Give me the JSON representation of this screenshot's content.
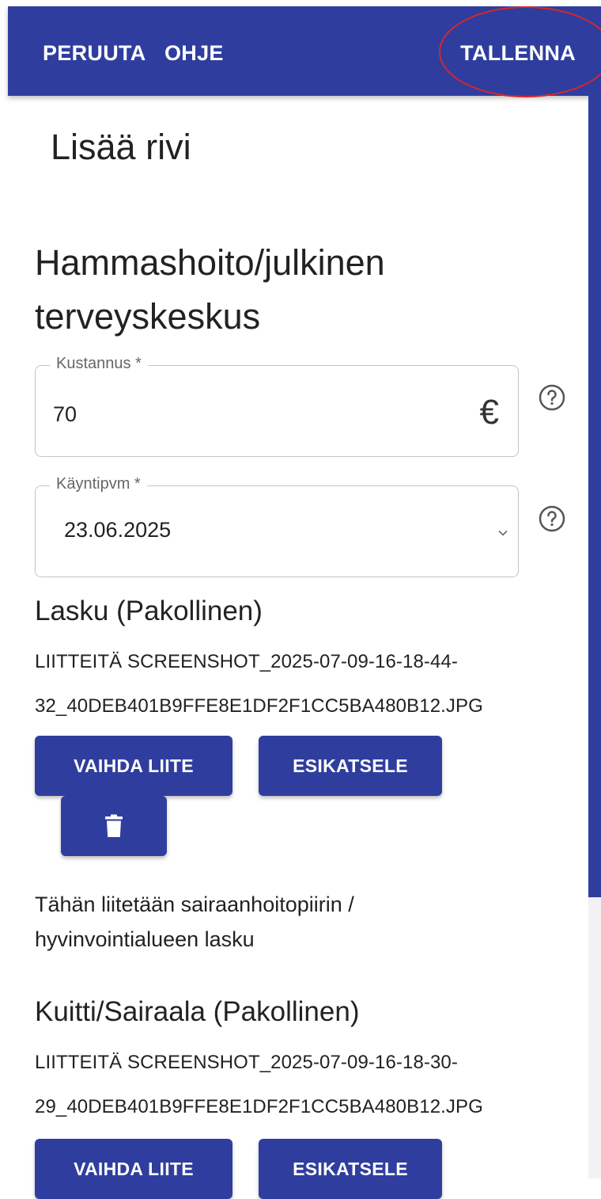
{
  "appbar": {
    "cancel_label": "PERUUTA",
    "help_label": "OHJE",
    "save_label": "TALLENNA"
  },
  "page_title": "Lisää rivi",
  "section_title": "Hammashoito/julkinen terveyskeskus",
  "cost": {
    "label": "Kustannus *",
    "value": "70",
    "currency_symbol": "€"
  },
  "visit_date": {
    "label": "Käyntipvm *",
    "value": "23.06.2025"
  },
  "invoice": {
    "title": "Lasku (Pakollinen)",
    "file_line1": "LIITTEITÄ SCREENSHOT_2025-07-09-16-18-44-",
    "file_line2": "32_40DEB401B9FFE8E1DF2F1CC5BA480B12.JPG",
    "change_label": "VAIHDA LIITE",
    "preview_label": "ESIKATSELE",
    "description_line1": "Tähän liitetään sairaanhoitopiirin /",
    "description_line2": "hyvinvointialueen lasku"
  },
  "receipt": {
    "title": "Kuitti/Sairaala (Pakollinen)",
    "file_line1": "LIITTEITÄ SCREENSHOT_2025-07-09-16-18-30-",
    "file_line2": "29_40DEB401B9FFE8E1DF2F1CC5BA480B12.JPG",
    "change_label": "VAIHDA LIITE",
    "preview_label": "ESIKATSELE"
  },
  "colors": {
    "primary": "#2f3e9e",
    "highlight_circle": "#d8262b"
  },
  "icons": [
    "help-circle-icon",
    "chevron-down-icon",
    "trash-icon"
  ]
}
